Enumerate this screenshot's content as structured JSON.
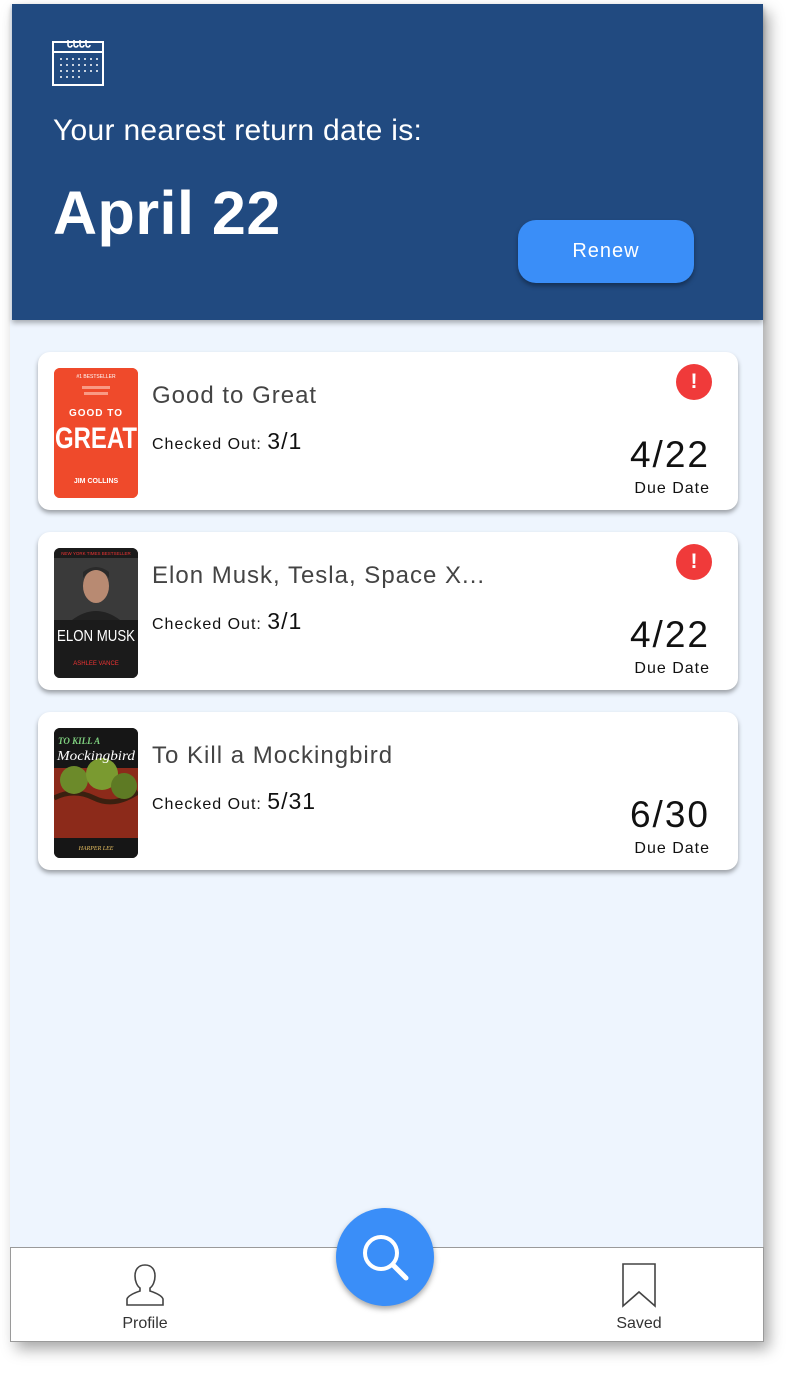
{
  "header": {
    "subtitle": "Your nearest return date is:",
    "nearest_date": "April 22",
    "renew_label": "Renew"
  },
  "books": [
    {
      "title": "Good to Great",
      "checked_out_label": "Checked Out:",
      "checked_out": "3/1",
      "due": "4/22",
      "due_label": "Due Date",
      "alert": "!",
      "cover": {
        "top_text": "#1 BESTSELLER",
        "line1": "GOOD TO",
        "line2": "GREAT",
        "author": "JIM COLLINS",
        "color": "#f04a2a"
      }
    },
    {
      "title": "Elon Musk, Tesla, Space X...",
      "checked_out_label": "Checked Out:",
      "checked_out": "3/1",
      "due": "4/22",
      "due_label": "Due Date",
      "alert": "!",
      "cover": {
        "top_text": "NEW YORK TIMES BESTSELLER",
        "line1": "ELON MUSK",
        "author": "ASHLEE VANCE",
        "color": "#1a1a1a"
      }
    },
    {
      "title": "To Kill a Mockingbird",
      "checked_out_label": "Checked Out:",
      "checked_out": "5/31",
      "due": "6/30",
      "due_label": "Due Date",
      "cover": {
        "line1": "TO KILL A",
        "line2": "Mockingbird",
        "author": "HARPER LEE",
        "color": "#161616"
      }
    }
  ],
  "nav": {
    "profile_label": "Profile",
    "saved_label": "Saved",
    "search_icon": "search-icon"
  },
  "colors": {
    "header_bg": "#214a80",
    "accent": "#3a8ef8",
    "alert": "#f03a3a",
    "background": "#eef5fe"
  }
}
